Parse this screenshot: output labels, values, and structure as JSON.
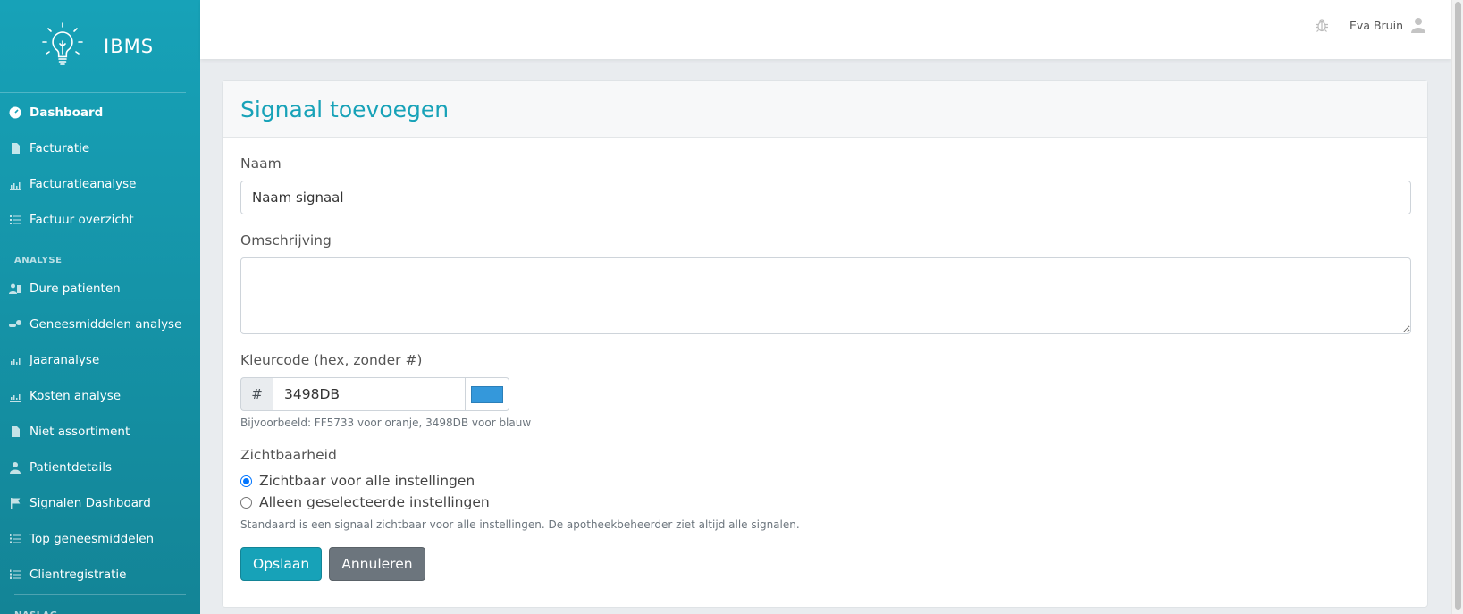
{
  "brand": {
    "name": "IBMS",
    "logo_icon": "lightbulb-icon"
  },
  "sidebar": {
    "items_main": [
      {
        "label": "Dashboard",
        "icon": "dashboard-icon",
        "active": true
      },
      {
        "label": "Facturatie",
        "icon": "file-icon"
      },
      {
        "label": "Facturatieanalyse",
        "icon": "chart-icon"
      },
      {
        "label": "Factuur overzicht",
        "icon": "list-icon"
      }
    ],
    "heading_analyse": "ANALYSE",
    "items_analyse": [
      {
        "label": "Dure patienten",
        "icon": "users-icon"
      },
      {
        "label": "Geneesmiddelen analyse",
        "icon": "pills-icon"
      },
      {
        "label": "Jaaranalyse",
        "icon": "chart-icon"
      },
      {
        "label": "Kosten analyse",
        "icon": "chart-icon"
      },
      {
        "label": "Niet assortiment",
        "icon": "file-icon"
      },
      {
        "label": "Patientdetails",
        "icon": "user-icon"
      },
      {
        "label": "Signalen Dashboard",
        "icon": "flag-icon"
      },
      {
        "label": "Top geneesmiddelen",
        "icon": "ordered-list-icon"
      },
      {
        "label": "Clientregistratie",
        "icon": "ordered-list-icon"
      }
    ],
    "heading_naslag": "NASLAG"
  },
  "topbar": {
    "user_name": "Eva Bruin",
    "bug_icon": "bug-icon",
    "user_icon": "user-icon"
  },
  "form": {
    "title": "Signaal toevoegen",
    "naam_label": "Naam",
    "naam_value": "Naam signaal",
    "omschrijving_label": "Omschrijving",
    "omschrijving_value": "",
    "kleur_label": "Kleurcode (hex, zonder #)",
    "kleur_prefix": "#",
    "kleur_value": "3498DB",
    "kleur_swatch": "#3498DB",
    "kleur_help": "Bijvoorbeeld: FF5733 voor oranje, 3498DB voor blauw",
    "zichtbaarheid_label": "Zichtbaarheid",
    "radio_all": "Zichtbaar voor alle instellingen",
    "radio_selected": "Alleen geselecteerde instellingen",
    "zichtbaarheid_help": "Standaard is een signaal zichtbaar voor alle instellingen. De apotheekbeheerder ziet altijd alle signalen.",
    "save_label": "Opslaan",
    "cancel_label": "Annuleren"
  },
  "colors": {
    "accent": "#17a2b8",
    "secondary": "#6c757d"
  }
}
